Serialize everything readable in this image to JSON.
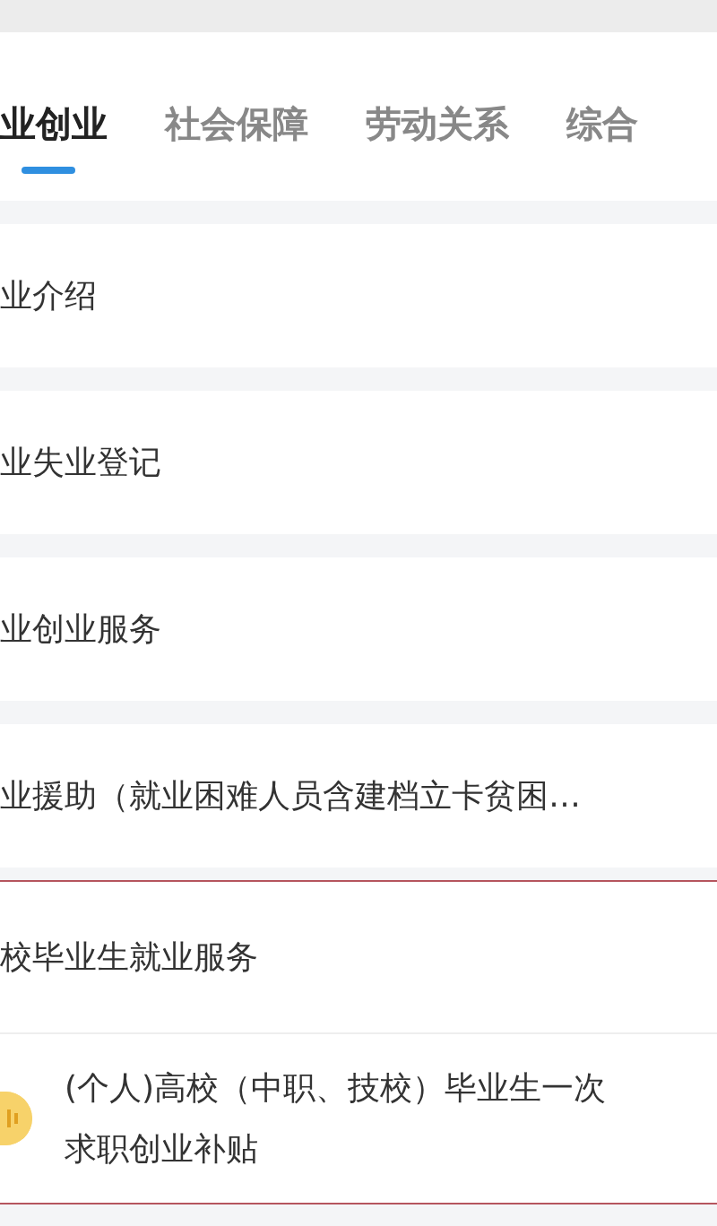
{
  "tabs": [
    {
      "label": "业创业",
      "selected": true
    },
    {
      "label": "社会保障",
      "selected": false
    },
    {
      "label": "劳动关系",
      "selected": false
    },
    {
      "label": "综合",
      "selected": false
    }
  ],
  "items": [
    {
      "kind": "item",
      "title": "业介绍"
    },
    {
      "kind": "item",
      "title": "业失业登记"
    },
    {
      "kind": "item",
      "title": "业创业服务"
    },
    {
      "kind": "item",
      "title": "业援助（就业困难人员含建档立卡贫困…"
    },
    {
      "kind": "group",
      "title": "校毕业生就业服务",
      "children": [
        {
          "lines": [
            "(个人)高校（中职、技校）毕业生一次",
            "求职创业补贴"
          ]
        }
      ]
    }
  ]
}
